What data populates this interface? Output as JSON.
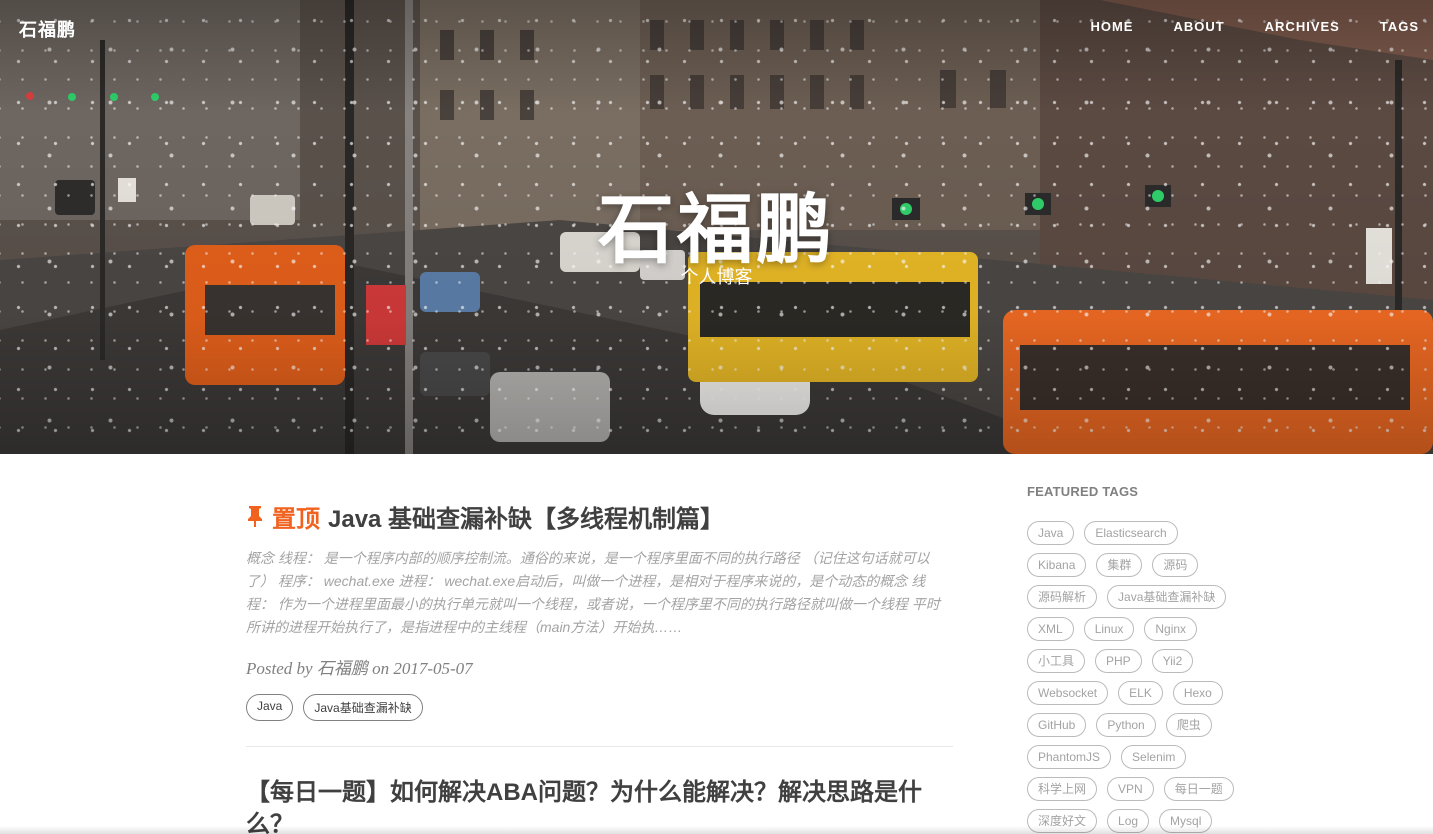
{
  "navbar": {
    "brand": "石福鹏",
    "links": [
      {
        "label": "HOME"
      },
      {
        "label": "ABOUT"
      },
      {
        "label": "ARCHIVES"
      },
      {
        "label": "TAGS"
      }
    ]
  },
  "hero": {
    "title": "石福鹏",
    "subtitle": "个人博客"
  },
  "posts": [
    {
      "pinned_label": "置顶",
      "title": "Java 基础查漏补缺【多线程机制篇】",
      "excerpt": "概念 线程： 是一个程序内部的顺序控制流。通俗的来说，是一个程序里面不同的执行路径 （记住这句话就可以了） 程序： wechat.exe 进程： wechat.exe启动后，叫做一个进程，是相对于程序来说的，是个动态的概念 线程： 作为一个进程里面最小的执行单元就叫一个线程，或者说，一个程序里不同的执行路径就叫做一个线程 平时所讲的进程开始执行了，是指进程中的主线程（main方法）开始执……",
      "meta": "Posted by 石福鹏 on 2017-05-07",
      "tags": [
        "Java",
        "Java基础查漏补缺"
      ]
    },
    {
      "title": "【每日一题】如何解决ABA问题？为什么能解决？解决思路是什么？"
    }
  ],
  "sidebar": {
    "heading": "FEATURED TAGS",
    "tags": [
      "Java",
      "Elasticsearch",
      "Kibana",
      "集群",
      "源码",
      "源码解析",
      "Java基础查漏补缺",
      "XML",
      "Linux",
      "Nginx",
      "小工具",
      "PHP",
      "Yii2",
      "Websocket",
      "ELK",
      "Hexo",
      "GitHub",
      "Python",
      "爬虫",
      "PhantomJS",
      "Selenim",
      "科学上网",
      "VPN",
      "每日一题",
      "深度好文",
      "Log",
      "Mysql"
    ]
  },
  "colors": {
    "accent": "#f0621e",
    "text": "#404040",
    "muted": "#a3a3a3"
  }
}
